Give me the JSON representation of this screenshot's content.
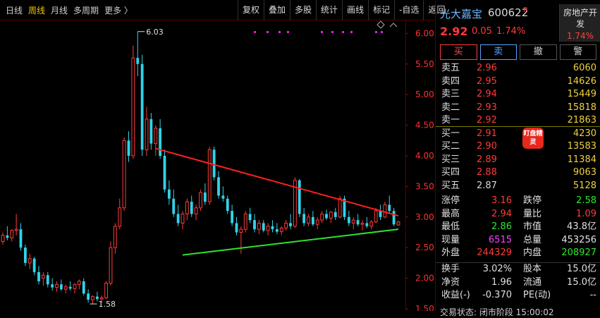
{
  "toolbar": {
    "periods": [
      "日线",
      "周线",
      "月线",
      "多周期",
      "更多 〉"
    ],
    "active_period": "周线",
    "actions": [
      "复权",
      "叠加",
      "多股",
      "统计",
      "画线",
      "标记",
      "-自选",
      "返回"
    ]
  },
  "stock": {
    "name": "光大嘉宝",
    "code": "600622",
    "flag": "R",
    "price": "2.92",
    "change": "0.05",
    "change_pct": "1.74%",
    "sector_name": "房地产开发",
    "sector_pct": "1.74%"
  },
  "trade_buttons": {
    "buy": "买",
    "sell": "卖",
    "cancel": "撤",
    "alert": "警"
  },
  "order_book": {
    "asks": [
      {
        "label": "卖五",
        "price": "2.96",
        "volume": "6060"
      },
      {
        "label": "卖四",
        "price": "2.95",
        "volume": "14626"
      },
      {
        "label": "卖三",
        "price": "2.94",
        "volume": "15449"
      },
      {
        "label": "卖二",
        "price": "2.93",
        "volume": "15818"
      },
      {
        "label": "卖一",
        "price": "2.92",
        "volume": "21863"
      }
    ],
    "bids": [
      {
        "label": "买一",
        "price": "2.91",
        "volume": "4230"
      },
      {
        "label": "买二",
        "price": "2.90",
        "volume": "13583"
      },
      {
        "label": "买三",
        "price": "2.89",
        "volume": "11384"
      },
      {
        "label": "买四",
        "price": "2.88",
        "volume": "9063"
      },
      {
        "label": "买五",
        "price": "2.87",
        "volume": "5128"
      }
    ],
    "badge": "盯盘精灵"
  },
  "stats": [
    {
      "l1": "涨停",
      "v1": "3.16",
      "c1": "red",
      "l2": "跌停",
      "v2": "2.58",
      "c2": "green"
    },
    {
      "l1": "最高",
      "v1": "2.94",
      "c1": "red",
      "l2": "量比",
      "v2": "1.09",
      "c2": "red"
    },
    {
      "l1": "最低",
      "v1": "2.86",
      "c1": "green",
      "l2": "市值",
      "v2": "43.8亿",
      "c2": "white"
    },
    {
      "l1": "现量",
      "v1": "6515",
      "c1": "magenta",
      "l2": "总量",
      "v2": "453256",
      "c2": "white"
    },
    {
      "l1": "外盘",
      "v1": "244329",
      "c1": "red",
      "l2": "内盘",
      "v2": "208927",
      "c2": "green"
    }
  ],
  "stats2": [
    {
      "l1": "换手",
      "v1": "3.02%",
      "c1": "white",
      "l2": "股本",
      "v2": "15.0亿",
      "c2": "white"
    },
    {
      "l1": "净资",
      "v1": "1.96",
      "c1": "white",
      "l2": "流通",
      "v2": "15.0亿",
      "c2": "white"
    },
    {
      "l1": "收益(-)",
      "v1": "-0.370",
      "c1": "white",
      "l2": "PE(动)",
      "v2": "--",
      "c2": "white"
    }
  ],
  "bottom_text": "交易状态: 闭市阶段 15:00:02",
  "colors": {
    "up": "#ff3a3a",
    "down": "#31d3e8",
    "trend_upper": "#ff2020",
    "trend_lower": "#30e030",
    "axis_label": "#ff3030"
  },
  "chart_data": {
    "type": "candlestick",
    "ylim": [
      1.5,
      6.2
    ],
    "y_ticks": [
      "6.00",
      "5.50",
      "5.00",
      "4.50",
      "4.00",
      "3.50",
      "3.00",
      "2.50",
      "2.00",
      "1.50"
    ],
    "annotations": [
      {
        "text": "6.03",
        "value": 6.03,
        "bar": 30
      },
      {
        "text": "1.58",
        "value": 1.58,
        "bar": 20
      }
    ],
    "candles": [
      [
        2.6,
        2.75,
        2.55,
        2.7
      ],
      [
        2.7,
        2.85,
        2.62,
        2.66
      ],
      [
        2.66,
        2.8,
        2.6,
        2.78
      ],
      [
        2.78,
        3.05,
        2.7,
        2.8
      ],
      [
        2.8,
        2.9,
        2.45,
        2.5
      ],
      [
        2.5,
        2.55,
        2.2,
        2.25
      ],
      [
        2.25,
        2.4,
        2.15,
        2.32
      ],
      [
        2.32,
        2.35,
        2.05,
        2.1
      ],
      [
        2.1,
        2.2,
        1.9,
        1.95
      ],
      [
        2.0,
        2.1,
        1.88,
        2.05
      ],
      [
        2.05,
        2.1,
        1.85,
        1.9
      ],
      [
        1.9,
        2.0,
        1.8,
        1.85
      ],
      [
        1.85,
        1.95,
        1.78,
        1.9
      ],
      [
        1.9,
        1.98,
        1.8,
        1.82
      ],
      [
        1.82,
        1.9,
        1.75,
        1.86
      ],
      [
        1.86,
        1.95,
        1.8,
        1.83
      ],
      [
        1.83,
        1.92,
        1.75,
        1.9
      ],
      [
        1.9,
        1.98,
        1.82,
        1.95
      ],
      [
        1.95,
        2.0,
        1.72,
        1.75
      ],
      [
        1.75,
        1.82,
        1.6,
        1.65
      ],
      [
        1.65,
        1.72,
        1.58,
        1.7
      ],
      [
        1.7,
        1.78,
        1.62,
        1.66
      ],
      [
        1.66,
        1.72,
        1.6,
        1.68
      ],
      [
        1.68,
        1.95,
        1.66,
        1.92
      ],
      [
        1.92,
        2.6,
        1.88,
        2.5
      ],
      [
        2.5,
        2.9,
        2.4,
        2.85
      ],
      [
        2.85,
        3.3,
        2.8,
        3.15
      ],
      [
        3.15,
        4.3,
        3.1,
        4.25
      ],
      [
        4.25,
        4.4,
        3.9,
        4.0
      ],
      [
        4.0,
        5.8,
        3.95,
        5.6
      ],
      [
        5.6,
        6.03,
        5.3,
        5.5
      ],
      [
        5.5,
        5.65,
        4.0,
        4.1
      ],
      [
        4.1,
        4.8,
        4.0,
        4.6
      ],
      [
        4.6,
        4.7,
        4.1,
        4.2
      ],
      [
        4.2,
        4.5,
        4.0,
        4.45
      ],
      [
        4.45,
        4.6,
        3.95,
        4.0
      ],
      [
        4.0,
        4.1,
        3.4,
        3.45
      ],
      [
        3.45,
        3.6,
        3.2,
        3.3
      ],
      [
        3.3,
        3.45,
        3.0,
        3.05
      ],
      [
        3.05,
        3.2,
        2.85,
        2.9
      ],
      [
        2.9,
        3.1,
        2.8,
        3.05
      ],
      [
        3.05,
        3.3,
        2.95,
        3.25
      ],
      [
        3.25,
        3.35,
        3.0,
        3.05
      ],
      [
        3.05,
        3.2,
        2.95,
        3.15
      ],
      [
        3.15,
        3.45,
        3.1,
        3.4
      ],
      [
        3.4,
        3.55,
        3.2,
        3.25
      ],
      [
        3.25,
        4.15,
        3.2,
        4.1
      ],
      [
        4.1,
        4.15,
        3.6,
        3.65
      ],
      [
        3.65,
        3.75,
        3.3,
        3.35
      ],
      [
        3.35,
        3.5,
        3.25,
        3.3
      ],
      [
        3.3,
        3.35,
        3.05,
        3.1
      ],
      [
        3.1,
        3.2,
        2.85,
        2.9
      ],
      [
        2.9,
        3.0,
        2.7,
        2.75
      ],
      [
        2.75,
        2.85,
        2.4,
        2.8
      ],
      [
        2.8,
        3.1,
        2.75,
        3.05
      ],
      [
        3.05,
        3.15,
        2.9,
        2.95
      ],
      [
        2.95,
        3.05,
        2.75,
        2.8
      ],
      [
        2.8,
        2.95,
        2.72,
        2.9
      ],
      [
        2.9,
        2.95,
        2.75,
        2.78
      ],
      [
        2.78,
        2.9,
        2.7,
        2.85
      ],
      [
        2.85,
        2.95,
        2.75,
        2.8
      ],
      [
        2.8,
        2.9,
        2.72,
        2.76
      ],
      [
        2.76,
        2.85,
        2.7,
        2.82
      ],
      [
        2.82,
        2.95,
        2.78,
        2.9
      ],
      [
        2.9,
        3.05,
        2.8,
        2.85
      ],
      [
        2.85,
        3.65,
        2.82,
        3.6
      ],
      [
        3.6,
        3.62,
        3.0,
        3.05
      ],
      [
        3.05,
        3.15,
        2.85,
        2.9
      ],
      [
        2.9,
        3.05,
        2.85,
        3.0
      ],
      [
        3.0,
        3.1,
        2.85,
        2.88
      ],
      [
        2.88,
        3.0,
        2.8,
        2.95
      ],
      [
        2.95,
        3.1,
        2.9,
        3.05
      ],
      [
        3.05,
        3.12,
        2.95,
        2.98
      ],
      [
        2.98,
        3.1,
        2.9,
        3.08
      ],
      [
        3.08,
        3.15,
        2.95,
        3.0
      ],
      [
        3.0,
        3.35,
        2.98,
        3.3
      ],
      [
        3.3,
        3.35,
        2.95,
        3.0
      ],
      [
        3.0,
        3.1,
        2.85,
        2.9
      ],
      [
        2.9,
        3.0,
        2.8,
        2.95
      ],
      [
        2.95,
        3.05,
        2.85,
        2.88
      ],
      [
        2.88,
        2.95,
        2.78,
        2.9
      ],
      [
        2.9,
        3.0,
        2.82,
        2.85
      ],
      [
        2.85,
        2.95,
        2.8,
        2.92
      ],
      [
        2.92,
        3.15,
        2.9,
        3.1
      ],
      [
        3.1,
        3.2,
        2.95,
        3.0
      ],
      [
        3.0,
        3.25,
        2.98,
        3.2
      ],
      [
        3.2,
        3.35,
        3.05,
        3.1
      ],
      [
        3.1,
        3.15,
        2.85,
        2.88
      ],
      [
        2.87,
        2.94,
        2.86,
        2.92
      ]
    ],
    "trendlines": [
      {
        "name": "upper",
        "from": [
          34,
          4.12
        ],
        "to": [
          88,
          3.02
        ]
      },
      {
        "name": "lower",
        "from": [
          40,
          2.38
        ],
        "to": [
          88,
          2.8
        ]
      }
    ]
  }
}
